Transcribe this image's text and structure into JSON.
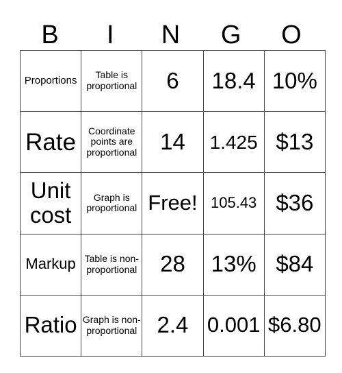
{
  "header": [
    "B",
    "I",
    "N",
    "G",
    "O"
  ],
  "rows": [
    [
      "Proportions",
      "Table is proportional",
      "6",
      "18.4",
      "10%"
    ],
    [
      "Rate",
      "Coordinate points are proportional",
      "14",
      "1.425",
      "$13"
    ],
    [
      "Unit cost",
      "Graph is proportional",
      "Free!",
      "105.43",
      "$36"
    ],
    [
      "Markup",
      "Table is non-proportional",
      "28",
      "13%",
      "$84"
    ],
    [
      "Ratio",
      "Graph is non-proportional",
      "2.4",
      "0.001",
      "$6.80"
    ]
  ]
}
